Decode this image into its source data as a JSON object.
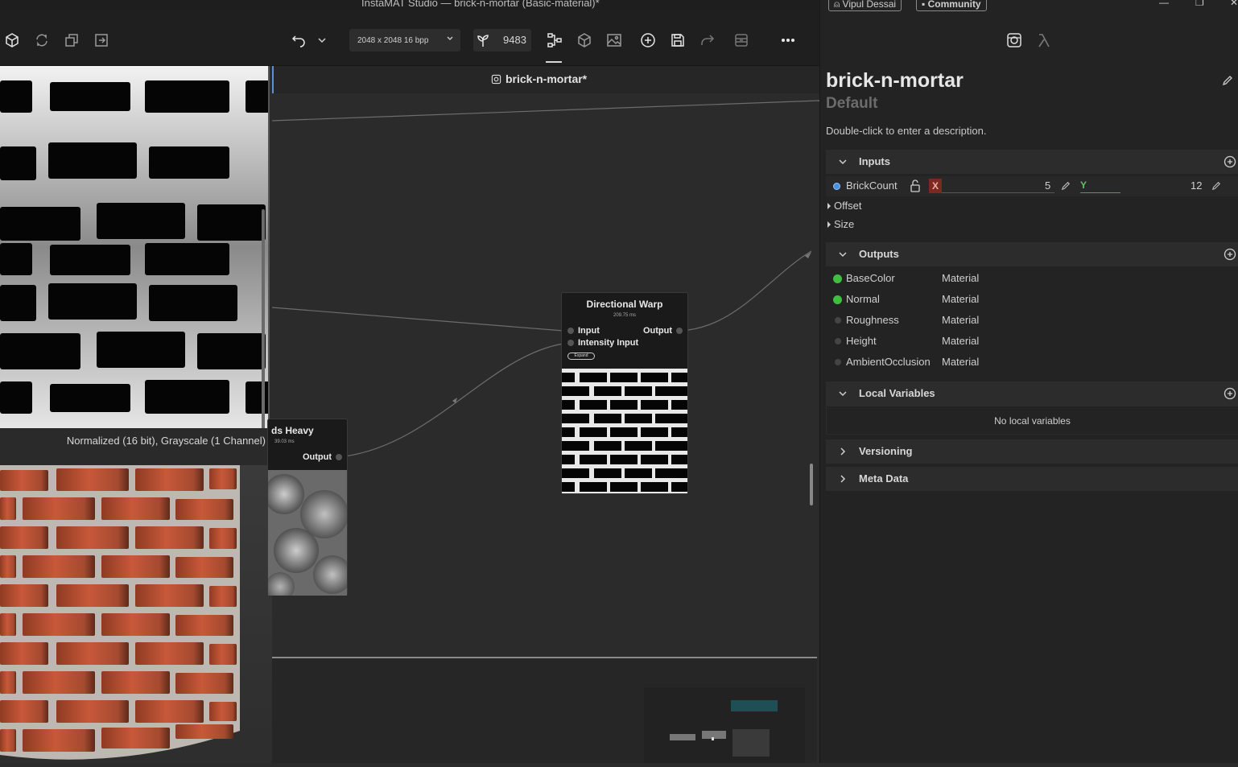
{
  "window": {
    "title": "InstaMAT Studio — brick-n-mortar (Basic-material)*",
    "user": "Vipul Dessai",
    "community": "Community"
  },
  "toolbar": {
    "resolution": "2048 x 2048 16 bpp",
    "seed": "9483"
  },
  "viewport": {
    "status": "Normalized (16 bit), Grayscale (1 Channel)"
  },
  "graph": {
    "tab_name": "brick-n-mortar*",
    "nodes": [
      {
        "title": "Directional Warp",
        "time": "209.75 ms",
        "inputs": [
          "Input",
          "Intensity Input"
        ],
        "output": "Output",
        "expand_label": "Expand"
      },
      {
        "title": "ds Heavy",
        "time": "39.03 ms",
        "output": "Output"
      }
    ]
  },
  "panel": {
    "title": "brick-n-mortar",
    "subtitle": "Default",
    "description": "Double-click to enter a description.",
    "inputs_label": "Inputs",
    "inputs": {
      "name": "BrickCount",
      "x_label": "X",
      "x_value": "5",
      "y_label": "Y",
      "y_value": "12",
      "groups": [
        "Offset",
        "Size"
      ]
    },
    "outputs_label": "Outputs",
    "outputs": [
      {
        "name": "BaseColor",
        "type": "Material",
        "connected": true
      },
      {
        "name": "Normal",
        "type": "Material",
        "connected": true
      },
      {
        "name": "Roughness",
        "type": "Material",
        "connected": false
      },
      {
        "name": "Height",
        "type": "Material",
        "connected": false
      },
      {
        "name": "AmbientOcclusion",
        "type": "Material",
        "connected": false
      }
    ],
    "local_vars_label": "Local Variables",
    "local_vars_empty": "No local variables",
    "versioning_label": "Versioning",
    "metadata_label": "Meta Data"
  },
  "colors": {
    "accent": "#5b8fd6",
    "connected": "#3fbf3f",
    "x_axis": "#c0392b",
    "y_axis": "#3fa34d"
  }
}
